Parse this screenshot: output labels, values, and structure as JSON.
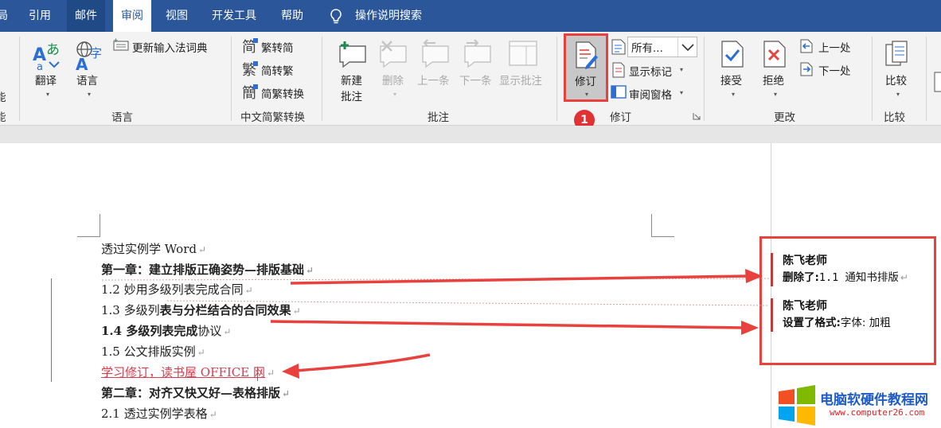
{
  "tabs": [
    {
      "label": "局",
      "active": false
    },
    {
      "label": "引用",
      "active": false
    },
    {
      "label": "邮件",
      "active": false
    },
    {
      "label": "审阅",
      "active": true
    },
    {
      "label": "视图",
      "active": false
    },
    {
      "label": "开发工具",
      "active": false
    },
    {
      "label": "帮助",
      "active": false
    }
  ],
  "search": {
    "label": "操作说明搜索",
    "icon": "lightbulb-icon"
  },
  "ribbon": {
    "left_cut": {
      "a": "能",
      "b": "能"
    },
    "language": {
      "translate_label": "翻译",
      "language_label": "语言",
      "update_ime_label": "更新输入法词典",
      "group_label": "语言"
    },
    "chinese": {
      "to_simplified": "繁转简",
      "to_traditional": "简转繁",
      "convert": "简繁转换",
      "group_label": "中文简繁转换"
    },
    "comments": {
      "new_comment_line1": "新建",
      "new_comment_line2": "批注",
      "delete_label": "删除",
      "previous_label": "上一条",
      "next_label": "下一条",
      "show_comments_label": "显示批注",
      "group_label": "批注"
    },
    "tracking": {
      "track_changes_label": "修订",
      "markup_select_value": "所有...",
      "show_markup_label": "显示标记",
      "reviewing_pane_label": "审阅窗格",
      "group_label": "修订",
      "badge": "1"
    },
    "changes": {
      "accept_label": "接受",
      "reject_label": "拒绝",
      "previous_label": "上一处",
      "next_label": "下一处",
      "group_label": "更改"
    },
    "compare": {
      "compare_label": "比较",
      "group_label": "比较"
    }
  },
  "document": {
    "lines": [
      {
        "text": "透过实例学 Word"
      },
      {
        "text": "第一章：建立排版正确姿势—排版基础"
      },
      {
        "text": "1.2 妙用多级列表完成合同"
      },
      {
        "prefix": "1.3 多级列",
        "bold": "表与分栏结合的合同效果"
      },
      {
        "bold": "1.4 多级列表完成",
        "suffix": "协议"
      },
      {
        "text": "1.5 公文排版实例"
      },
      {
        "text": "学习修订，读书屋 OFFICE 网"
      },
      {
        "text": "第二章：对齐又快又好—表格排版"
      },
      {
        "text": "2.1 透过实例学表格"
      }
    ],
    "paragraph_mark": "↵"
  },
  "markup_balloons": [
    {
      "author": "陈飞老师",
      "kind": "删除了:",
      "detail": "1.1 通知书排版"
    },
    {
      "author": "陈飞老师",
      "kind": "设置了格式:",
      "detail": "字体: 加粗"
    }
  ],
  "watermark": {
    "title": "电脑软硬件教程网",
    "url": "www.computer26.com"
  },
  "colors": {
    "tab_bar": "#2b579a",
    "ribbon": "#f3f3f3",
    "highlight_red": "#e8413e",
    "insert_red": "#d83b4c",
    "accent_blue": "#2b579a"
  }
}
